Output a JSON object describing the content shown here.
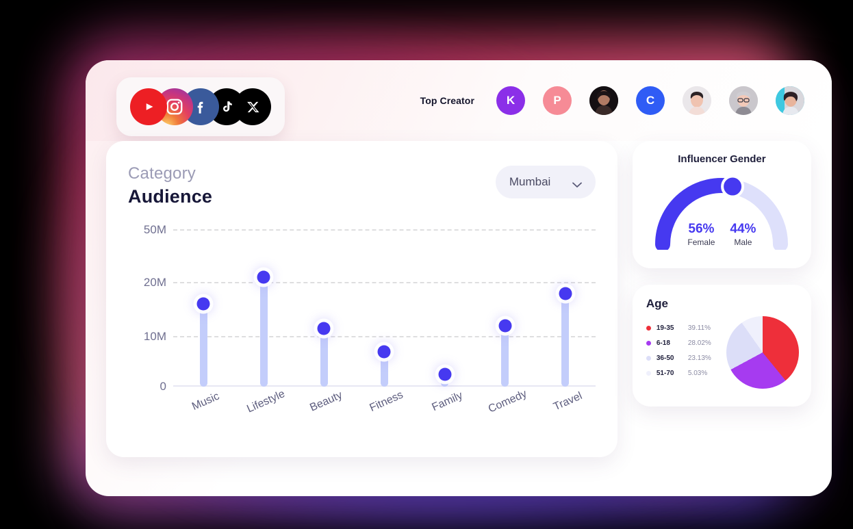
{
  "header": {
    "social_icons": [
      {
        "name": "youtube-icon",
        "color": "#ED1F24"
      },
      {
        "name": "instagram-icon",
        "color": "#E4405F"
      },
      {
        "name": "facebook-icon",
        "color": "#3A5A9B"
      },
      {
        "name": "tiktok-icon",
        "color": "#000000"
      },
      {
        "name": "x-twitter-icon",
        "color": "#000000"
      }
    ],
    "top_creator_label": "Top Creator",
    "creators": [
      {
        "initial": "K",
        "type": "initial",
        "color": "#8B2FE8"
      },
      {
        "initial": "P",
        "type": "initial",
        "color": "#F68B96"
      },
      {
        "initial": "",
        "type": "photo",
        "color": "#221a1c"
      },
      {
        "initial": "C",
        "type": "initial",
        "color": "#2F5CF5"
      },
      {
        "initial": "",
        "type": "photo",
        "color": "#e9e7ea"
      },
      {
        "initial": "",
        "type": "photo",
        "color": "#c9c6cb"
      },
      {
        "initial": "",
        "type": "photo",
        "color": "#3ec8e0"
      }
    ]
  },
  "main": {
    "category_label": "Category",
    "title": "Audience",
    "city_select": {
      "value": "Mumbai",
      "icon": "chevron-down-icon"
    }
  },
  "gender": {
    "title": "Influencer Gender",
    "female_pct": "56%",
    "female_label": "Female",
    "male_pct": "44%",
    "male_label": "Male",
    "female_value": 56,
    "male_value": 44,
    "arc_color": "#4639f0",
    "track_color": "#dee0fb"
  },
  "age": {
    "title": "Age",
    "rows": [
      {
        "range": "19-35",
        "pct": "39.11%",
        "value": 39.11,
        "color": "#EE2F3A"
      },
      {
        "range": "6-18",
        "pct": "28.02%",
        "value": 28.02,
        "color": "#A63BF0"
      },
      {
        "range": "36-50",
        "pct": "23.13%",
        "value": 23.13,
        "color": "#DCDEF8"
      },
      {
        "range": "51-70",
        "pct": "5.03%",
        "value": 5.03,
        "color": "#EFF0FC"
      }
    ]
  },
  "chart_data": {
    "type": "bar",
    "title": "Audience",
    "subtitle": "Category",
    "xlabel": "",
    "ylabel": "",
    "categories": [
      "Music",
      "Lifestyle",
      "Beauty",
      "Fitness",
      "Family",
      "Comedy",
      "Travel"
    ],
    "values": [
      16000000,
      23000000,
      11500000,
      7000000,
      2500000,
      12000000,
      18000000
    ],
    "value_labels": [
      "16M",
      "23M",
      "11.5M",
      "7M",
      "2.5M",
      "12M",
      "18M"
    ],
    "ytick_labels": [
      "0",
      "10M",
      "20M",
      "50M"
    ],
    "ytick_values": [
      0,
      10000000,
      20000000,
      50000000
    ],
    "ylim": [
      0,
      50000000
    ],
    "grid": true,
    "legend": "none",
    "bar_color": "#c3cdfb",
    "marker_color": "#4639f0"
  }
}
